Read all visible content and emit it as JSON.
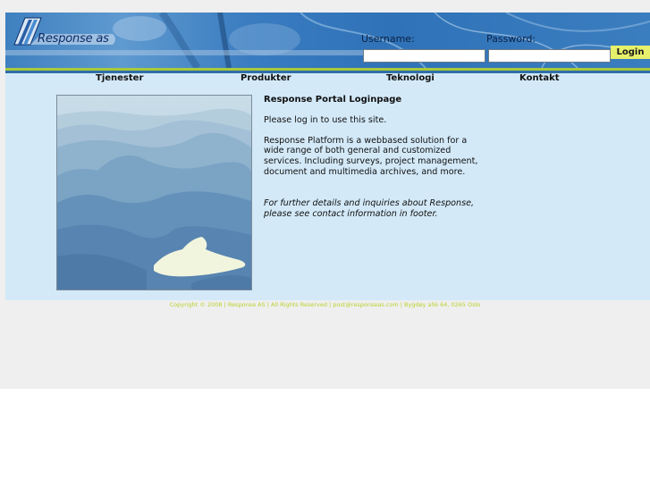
{
  "header": {
    "logo_text": "Response as",
    "username_label": "Username:",
    "username_value": "",
    "password_label": "Password:",
    "password_value": "",
    "login_label": "Login"
  },
  "nav": {
    "items": [
      {
        "label": "Tjenester"
      },
      {
        "label": "Produkter"
      },
      {
        "label": "Teknologi"
      },
      {
        "label": "Kontakt"
      }
    ]
  },
  "content": {
    "title": "Response Portal Loginpage",
    "intro": "Please log in to use this site.",
    "description": "Response Platform is a webbased solution for a wide range of both general and customized services. Including surveys, project management, document and multimedia archives, and more.",
    "further": "For further details and inquiries about Response, please see contact information in footer."
  },
  "footer": {
    "text": "Copyright © 2008 | Response AS | All Rights Reserved | post@responseas.com | Bygdøy allé 64, 0265 Oslo"
  },
  "colors": {
    "page_bg": "#efefef",
    "content_bg": "#d3e9f8",
    "header_blue": "#3a7cc0",
    "accent_green": "#a8c93a",
    "login_button": "#e6f06a",
    "footer_text": "#b9d12e"
  }
}
